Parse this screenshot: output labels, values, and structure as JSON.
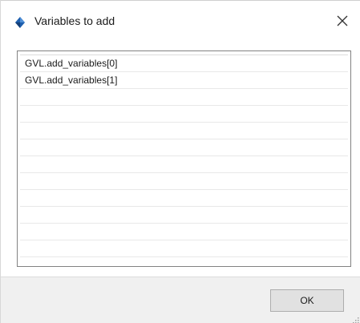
{
  "window": {
    "title": "Variables to add",
    "title_icon": "diamond-icon",
    "close_icon": "close-icon"
  },
  "variables_list": {
    "items": [
      "GVL.add_variables[0]",
      "GVL.add_variables[1]",
      "",
      "",
      "",
      "",
      "",
      "",
      "",
      "",
      "",
      ""
    ]
  },
  "footer": {
    "ok_label": "OK",
    "grip_icon": "resize-grip-icon"
  },
  "colors": {
    "icon_blue": "#1e5fae",
    "footer_bg": "#f0f0f0",
    "button_bg": "#e1e1e1",
    "list_border": "#828282"
  }
}
